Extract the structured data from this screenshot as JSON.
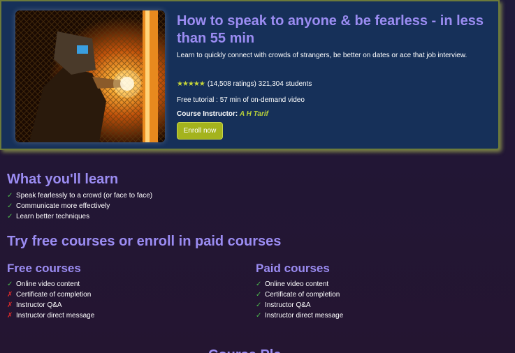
{
  "course": {
    "title": "How to speak to anyone & be fearless - in less than 55 min",
    "subtitle": "Learn to quickly connect with crowds of strangers, be better on dates or ace that job interview.",
    "stars": "★★★★★",
    "rating_text": "(14,508 ratings) 321,304 students",
    "tutorial_info": "Free tutorial : 57 min of on-demand video",
    "instructor_label": "Course Instructor:",
    "instructor_name": "A H Tarif",
    "enroll_label": "Enroll now",
    "image_icon": "welder-photo"
  },
  "learn": {
    "heading": "What you'll learn",
    "items": [
      "Speak fearlessly to a crowd (or face to face)",
      "Communicate more effectively",
      "Learn better techniques"
    ]
  },
  "compare": {
    "heading": "Try free courses or enroll in paid courses",
    "free": {
      "heading": "Free courses",
      "items": [
        {
          "label": "Online video content",
          "included": true
        },
        {
          "label": "Certificate of completion",
          "included": false
        },
        {
          "label": "Instructor Q&A",
          "included": false
        },
        {
          "label": "Instructor direct message",
          "included": false
        }
      ]
    },
    "paid": {
      "heading": "Paid courses",
      "items": [
        {
          "label": "Online video content",
          "included": true
        },
        {
          "label": "Certificate of completion",
          "included": true
        },
        {
          "label": "Instructor Q&A",
          "included": true
        },
        {
          "label": "Instructor direct message",
          "included": true
        }
      ]
    }
  },
  "next_section": {
    "heading_partial": "Course Pla"
  },
  "colors": {
    "accent": "#9b8cf2",
    "card_bg": "#163059",
    "button": "#a4b31d",
    "check": "#4cb84c",
    "cross": "#e02b2b"
  },
  "glyphs": {
    "check": "✓",
    "cross": "✗"
  }
}
